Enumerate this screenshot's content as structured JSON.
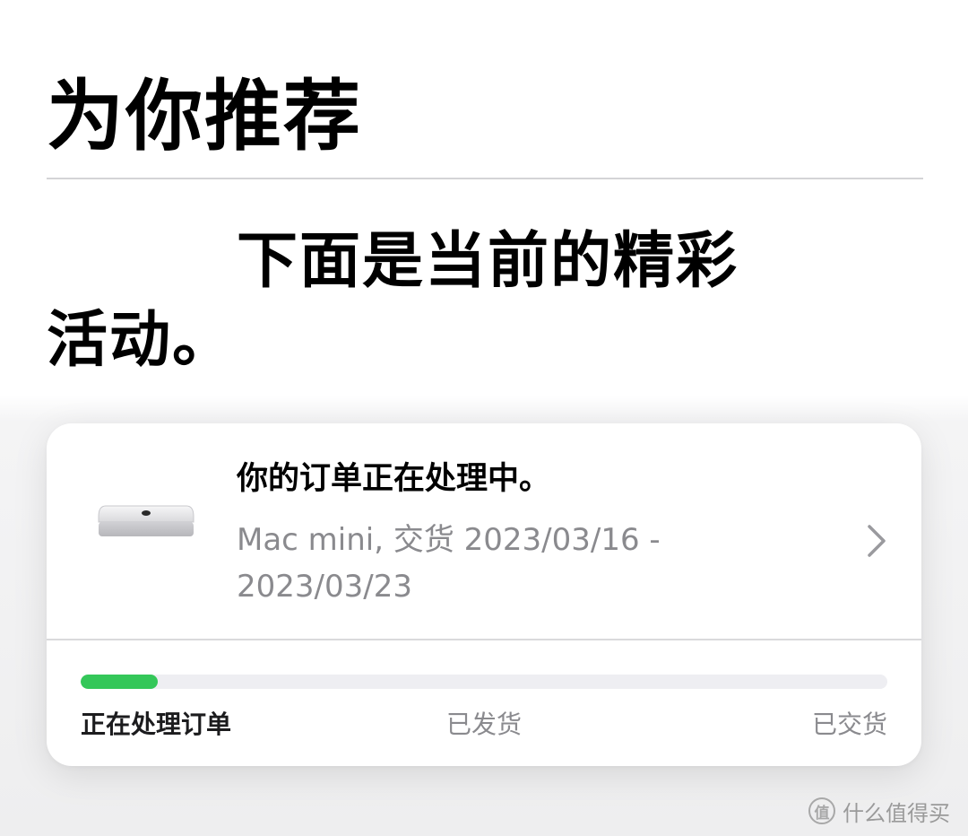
{
  "header": {
    "title": "为你推荐",
    "intro": "下面是当前的精彩活动。"
  },
  "order_card": {
    "product_icon": "mac-mini-thumbnail",
    "status": "你的订单正在处理中。",
    "detail": "Mac mini, 交货 2023/03/16 - 2023/03/23",
    "chevron_icon": "chevron-right-icon",
    "progress": {
      "fraction": 0.095,
      "color": "#34c759"
    },
    "stages": [
      "正在处理订单",
      "已发货",
      "已交货"
    ]
  },
  "watermark": {
    "logo_text": "值",
    "text": "什么值得买"
  }
}
